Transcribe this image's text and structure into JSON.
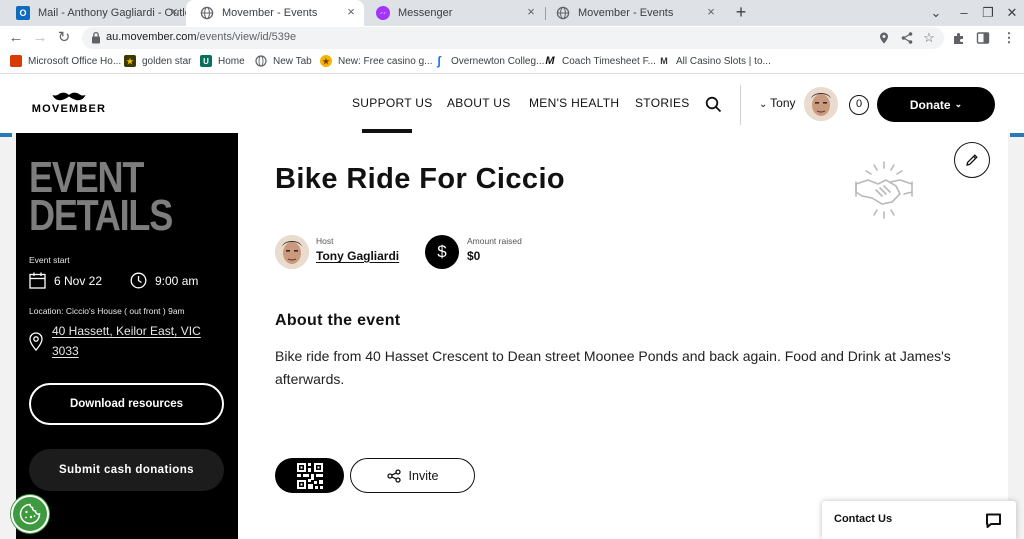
{
  "browser": {
    "tabs": [
      {
        "title": "Mail - Anthony Gagliardi - Outlook",
        "icon": "outlook-icon",
        "color": "#0f6cbd"
      },
      {
        "title": "Movember - Events",
        "icon": "globe-icon",
        "active": true
      },
      {
        "title": "Messenger",
        "icon": "messenger-icon",
        "color": "#a334fa"
      },
      {
        "title": "Movember - Events",
        "icon": "globe-icon"
      }
    ],
    "url_host": "au.movember.com",
    "url_path": "/events/view/id/539e",
    "bookmarks": [
      {
        "label": "Microsoft Office Ho...",
        "icon": "office-icon",
        "color": "#d83b01"
      },
      {
        "label": "golden star",
        "icon": "star-icon",
        "color": "#3a3a00"
      },
      {
        "label": "Home",
        "icon": "home-icon",
        "color": "#0b6e5b"
      },
      {
        "label": "New Tab",
        "icon": "globe-icon",
        "color": "#5f6368"
      },
      {
        "label": "New: Free casino g...",
        "icon": "casino-icon",
        "color": "#c58b00"
      },
      {
        "label": "Overnewton Colleg...",
        "icon": "overnewton-icon",
        "color": "#1a73e8"
      },
      {
        "label": "Coach Timesheet F...",
        "icon": "coach-icon",
        "color": "#111111"
      },
      {
        "label": "All Casino Slots | to...",
        "icon": "slots-icon",
        "color": "#333333"
      }
    ]
  },
  "header": {
    "logo_text": "MOVEMBER",
    "nav": [
      "SUPPORT US",
      "ABOUT US",
      "MEN'S HEALTH",
      "STORIES"
    ],
    "user_name": "Tony",
    "cart_count": "0",
    "donate_label": "Donate"
  },
  "panel": {
    "title_line1": "EVENT",
    "title_line2": "DETAILS",
    "event_start_label": "Event start",
    "date": "6 Nov 22",
    "time": "9:00 am",
    "location_note": "Location: Ciccio's House ( out front ) 9am",
    "address": "40 Hassett, Keilor East, VIC 3033",
    "download_label": "Download resources",
    "cash_label": "Submit cash donations"
  },
  "event": {
    "title": "Bike Ride For Ciccio",
    "host_label": "Host",
    "host_name": "Tony Gagliardi",
    "raised_label": "Amount raised",
    "raised_value": "$0",
    "dollar_symbol": "$",
    "about_heading": "About the event",
    "about_body": "Bike ride from 40 Hasset Crescent to Dean street Moonee Ponds and back again. Food and Drink at James's afterwards.",
    "invite_label": "Invite"
  },
  "contact": {
    "label": "Contact Us"
  },
  "colors": {
    "panel_bg": "#000000",
    "panel_title": "#7d7d7d",
    "cookie_green": "#3d9a3f"
  }
}
